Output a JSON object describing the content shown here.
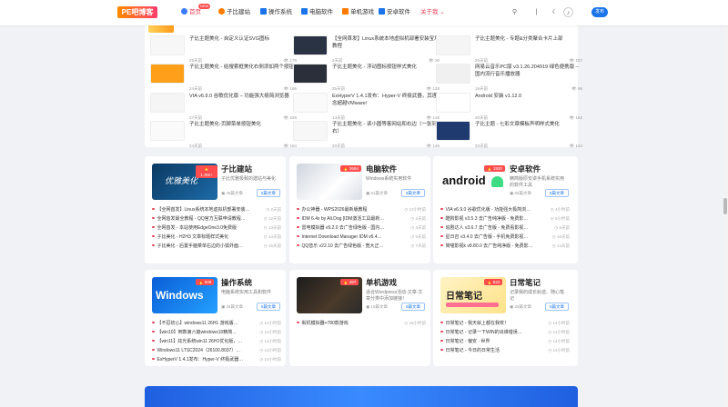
{
  "brand": {
    "logo_text": "PE吧博客"
  },
  "nav": {
    "items": [
      {
        "label": "首页",
        "icon": "home-icon",
        "color": "#e6425a",
        "active": true
      },
      {
        "label": "子比建站",
        "icon": "compass-icon",
        "color": "#ff7a00",
        "active": false
      },
      {
        "label": "操作系统",
        "icon": "windows-icon",
        "color": "#1a73e8",
        "active": false
      },
      {
        "label": "电脑软件",
        "icon": "desktop-icon",
        "color": "#1a73e8",
        "active": false
      },
      {
        "label": "单机游戏",
        "icon": "gamepad-icon",
        "color": "#ff7a00",
        "active": false
      },
      {
        "label": "安卓软件",
        "icon": "android-icon",
        "color": "#1a73e8",
        "active": false
      },
      {
        "label": "关于我 ⌄",
        "icon": "",
        "color": "#e6425a",
        "active": true
      }
    ],
    "hot_badge": "NEW",
    "publish_label": "发布"
  },
  "recent": {
    "items": [
      {
        "title": "子比主题美化 - 自定义认证SVG图标",
        "author": "25天前",
        "views": "179",
        "thumb": "#f7f7f7"
      },
      {
        "title": "【全网首发】Linux系统本地虚拟机部署安装宝塔教程",
        "author": "2天前",
        "views": "30",
        "thumb": "#2a3344"
      },
      {
        "title": "子比主题美化 - 专题&分类聚合卡片上部",
        "author": "25天前",
        "views": "157",
        "thumb": "#f5f5f5"
      },
      {
        "title": "子比主题美化 - 给搜索框美化右侧添加两个按钮",
        "author": "24天前",
        "views": "166",
        "thumb": "#ff9f1a"
      },
      {
        "title": "子比主题美化 - 浮动图标按钮样式美化",
        "author": "25天前",
        "views": "128",
        "thumb": "#2a2f3a"
      },
      {
        "title": "网易云音乐PC版 v3.1.26.204919 绿色便携版 – 国内流行音乐播放器",
        "author": "16天前",
        "views": "96",
        "thumb": "#f0f0f0"
      },
      {
        "title": "VIA v6.9.0 谷歌优化版 – 功能强大极简浏览器",
        "author": "27天前",
        "views": "226",
        "thumb": "#f5f5f5"
      },
      {
        "title": "ExHyperV 1.4.1发布：Hyper-V 终极武器，其理念超越VMware!",
        "author": "14天前",
        "views": "128",
        "thumb": "#fafafa"
      },
      {
        "title": "Android 安装 v1.12.0",
        "author": "20天前",
        "views": "162",
        "thumb": "#ffffff"
      },
      {
        "title": "子比主题美化-页脚菜单按钮美化",
        "author": "24天前",
        "views": "154",
        "thumb": "#fafafa"
      },
      {
        "title": "子比主题美化 - 读小圆等客网站和右边（一张到右）",
        "author": "20天前",
        "views": "149",
        "thumb": "#f7f7f7"
      },
      {
        "title": "子比主题 - 七彩文章模板声明样式美化",
        "author": "23天前",
        "views": "144",
        "thumb": "#1e3a6e"
      }
    ]
  },
  "categories": [
    {
      "name": "子比建站",
      "badge": "1.3W+",
      "desc": "子比优雅极致的建站与美化",
      "count": "45篇文章",
      "btn": "5篇文章",
      "img_text": "优雅美化",
      "img_bg": "linear-gradient(135deg,#0b3a63,#1c6aa6)",
      "items": [
        {
          "title": "【全网首发】Linux系统本地虚拟机部署安装…",
          "time": "2天前"
        },
        {
          "title": "全网首发最全教程 - QQ官方互联申请教程…",
          "time": "12天前"
        },
        {
          "title": "全网首发 - 本站使用EdgeOne3.0免费版",
          "time": "13天前"
        },
        {
          "title": "子比美化 - H2H3 文章标题样式美化",
          "time": "14天前"
        },
        {
          "title": "子比美化 - 后置手脑菜单右边的小狐外面…",
          "time": "15天前"
        }
      ]
    },
    {
      "name": "电脑软件",
      "badge": "2694",
      "desc": "Windows系统实用软件",
      "count": "61篇文章",
      "btn": "5篇文章",
      "img_text": "",
      "img_bg": "linear-gradient(135deg,#cfd5de,#ffffff 60%,#d9dee6)",
      "items": [
        {
          "title": "办公神器 - WPS2026最新版教程",
          "time": "13小时前"
        },
        {
          "title": "IDM 6.4x by Ali.Dog [IDM激活工具最新…",
          "time": "2天前"
        },
        {
          "title": "雷电模拟器 v9.2.0 去广告绿色版 - 国内…",
          "time": "3天前"
        },
        {
          "title": "Internet Download Manager IDM v6.4…",
          "time": "5天前"
        },
        {
          "title": "QQ音乐 v22.10 去广告绿色版 - 宽大正…",
          "time": "7天前"
        }
      ]
    },
    {
      "name": "安卓软件",
      "badge": "1930",
      "desc": "精简版原安卓手机系统实用的软件工具",
      "count": "65篇文章",
      "btn": "5篇文章",
      "img_text": "android",
      "img_bg": "#ffffff",
      "items": [
        {
          "title": "VIA v6.9.0 谷歌优化版 - 功能强大极简浏…",
          "time": "4小时前"
        },
        {
          "title": "酷狗影视 v3.5.3 去广告纯净版 - 免费影…",
          "time": "5小时前"
        },
        {
          "title": "追剧达人 v3.6.7 去广告版 - 免费看影视…",
          "time": "5天前"
        },
        {
          "title": "星日召 v3.4.0 去广告版 - 手机免费影视…",
          "time": "10天前"
        },
        {
          "title": "简喵影视k v8.80.0 去广告纯净版 - 免费影…",
          "time": "14天前"
        }
      ]
    },
    {
      "name": "操作系统",
      "badge": "508",
      "desc": "电脑系统实用工具和软件",
      "count": "34篇文章",
      "btn": "5篇文章",
      "img_text": "Windows",
      "img_bg": "linear-gradient(135deg,#0a5ed7,#24a0ff)",
      "items": [
        {
          "title": "【不忍初心】windows11 26H1 游戏版…",
          "time": "14小时前"
        },
        {
          "title": "【win10】倒数第六篇windows10精简…",
          "time": "14小时前"
        },
        {
          "title": "【win11】炫光系统win11 26H1优化版，…",
          "time": "14小时前"
        },
        {
          "title": "Windows11 LTSC2024（26100.8037）…",
          "time": "14小时前"
        },
        {
          "title": "ExHyperV 1.4.1发布：Hyper-V 终极武器…",
          "time": "14小时前"
        }
      ]
    },
    {
      "name": "单机游戏",
      "badge": "487",
      "desc": "适合Wordpress活动-文章-文章分类中添加链接！",
      "count": "16篇文章",
      "btn": "5篇文章",
      "img_text": "",
      "img_bg": "linear-gradient(135deg,#1c1c1c,#4a3a2a 60%,#2b2b2b)",
      "items": [
        {
          "title": "街机模拟器+780款游戏",
          "time": "15小时前"
        }
      ]
    },
    {
      "name": "日常笔记",
      "badge": "622",
      "desc": "记录我的成长轨迹、随心笔记",
      "count": "26篇文章",
      "btn": "5篇文章",
      "img_text": "日常笔记",
      "img_bg": "linear-gradient(135deg,#fff3c4,#ffe28a)",
      "items": [
        {
          "title": "日常笔记 - 我天就上都在我校！",
          "time": "14小时前"
        },
        {
          "title": "日常笔记 - 记录一下WIN的出谁错误…",
          "time": "14小时前"
        },
        {
          "title": "日常笔记 - 偏安 · 世界",
          "time": "14小时前"
        },
        {
          "title": "日常笔记 - 今日的日常生活",
          "time": "14小时前"
        }
      ]
    }
  ]
}
